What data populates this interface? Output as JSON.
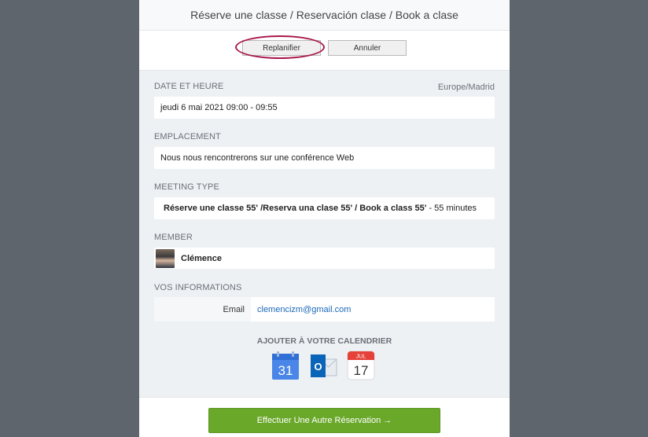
{
  "header": {
    "title": "Réserve une classe / Reservación clase / Book a clase"
  },
  "actions": {
    "reschedule_label": "Replanifier",
    "cancel_label": "Annuler"
  },
  "datetime": {
    "label": "DATE ET HEURE",
    "timezone": "Europe/Madrid",
    "value": "jeudi 6 mai 2021 09:00 - 09:55"
  },
  "location": {
    "label": "EMPLACEMENT",
    "value": "Nous nous rencontrerons sur une conférence Web"
  },
  "meeting_type": {
    "label": "MEETING TYPE",
    "name": "Réserve une classe 55' /Reserva una clase 55' / Book a class 55'",
    "duration": " - 55 minutes"
  },
  "member": {
    "label": "MEMBER",
    "name": "Clémence"
  },
  "info": {
    "label": "VOS INFORMATIONS",
    "email_key": "Email",
    "email_value": "clemencizm@gmail.com"
  },
  "calendar": {
    "title": "AJOUTER À VOTRE CALENDRIER",
    "google_day": "31",
    "outlook_letter": "O",
    "apple_month": "JUL",
    "apple_day": "17"
  },
  "footer": {
    "cta_label": "Effectuer Une Autre Réservation →"
  },
  "colors": {
    "accent_ring": "#a8184c",
    "cta_green": "#6aa82a",
    "link_blue": "#1a68b8"
  }
}
